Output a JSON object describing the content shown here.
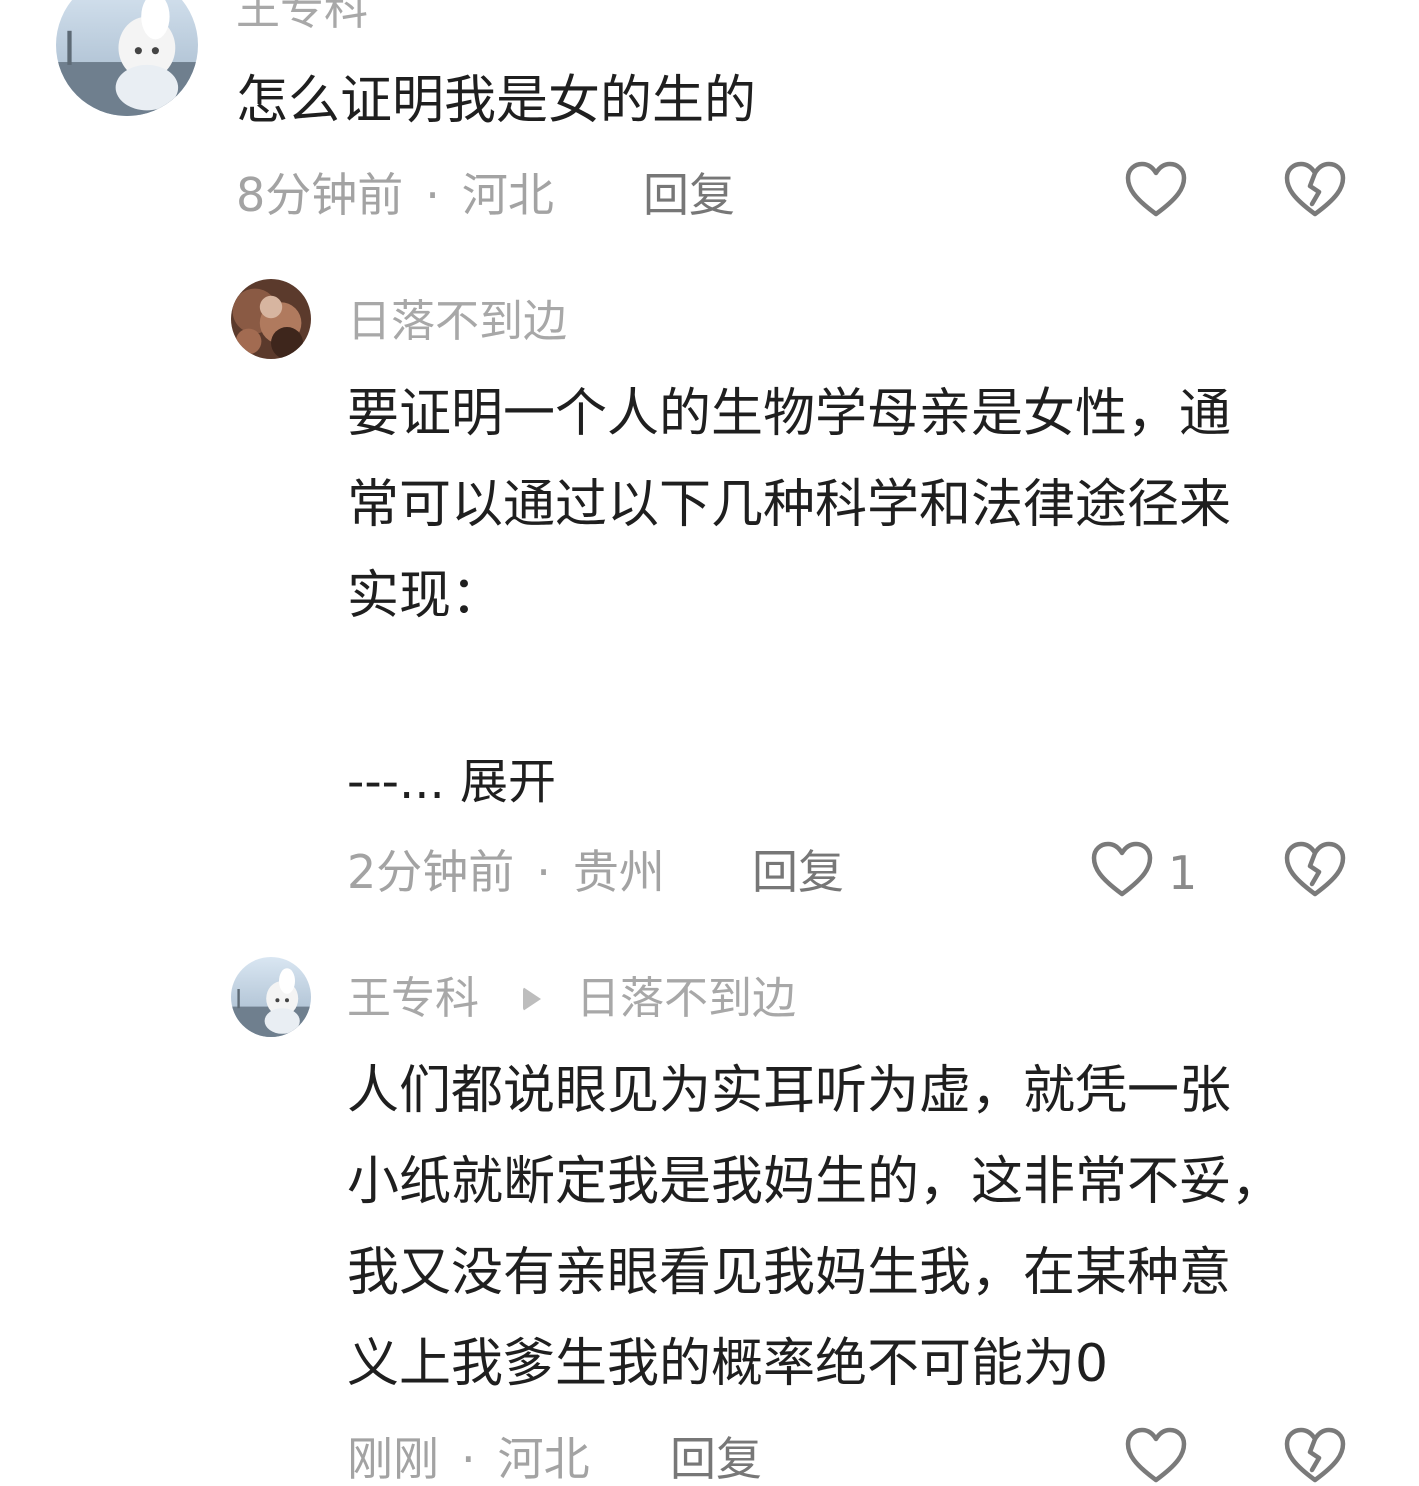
{
  "comments": [
    {
      "author": "王专科",
      "avatar": "avatar-anime-icon",
      "lines": [
        "怎么证明我是女的生的"
      ],
      "time": "8分钟前",
      "location": "河北",
      "reply_label": "回复",
      "likes": ""
    },
    {
      "author": "日落不到边",
      "avatar": "avatar-photo-icon",
      "lines": [
        "要证明一个人的生物学母亲是女性，通",
        "常可以通过以下几种科学和法律途径来",
        "实现："
      ],
      "expand_label": "---... 展开",
      "time": "2分钟前",
      "location": "贵州",
      "reply_label": "回复",
      "likes": "1"
    },
    {
      "author": "王专科",
      "reply_to": "日落不到边",
      "avatar": "avatar-anime-icon",
      "lines": [
        "人们都说眼见为实耳听为虚，就凭一张",
        "小纸就断定我是我妈生的，这非常不妥，",
        "我又没有亲眼看见我妈生我，在某种意",
        "义上我爹生我的概率绝不可能为0"
      ],
      "time": "刚刚",
      "location": "河北",
      "reply_label": "回复",
      "likes": ""
    }
  ],
  "colors": {
    "text_primary": "#1f1f1f",
    "text_secondary": "#a3a3a3",
    "icon": "#7a7a7a"
  },
  "icons": {
    "like": "heart-outline-icon",
    "dislike": "broken-heart-icon",
    "reply_arrow": "triangle-right-icon"
  }
}
